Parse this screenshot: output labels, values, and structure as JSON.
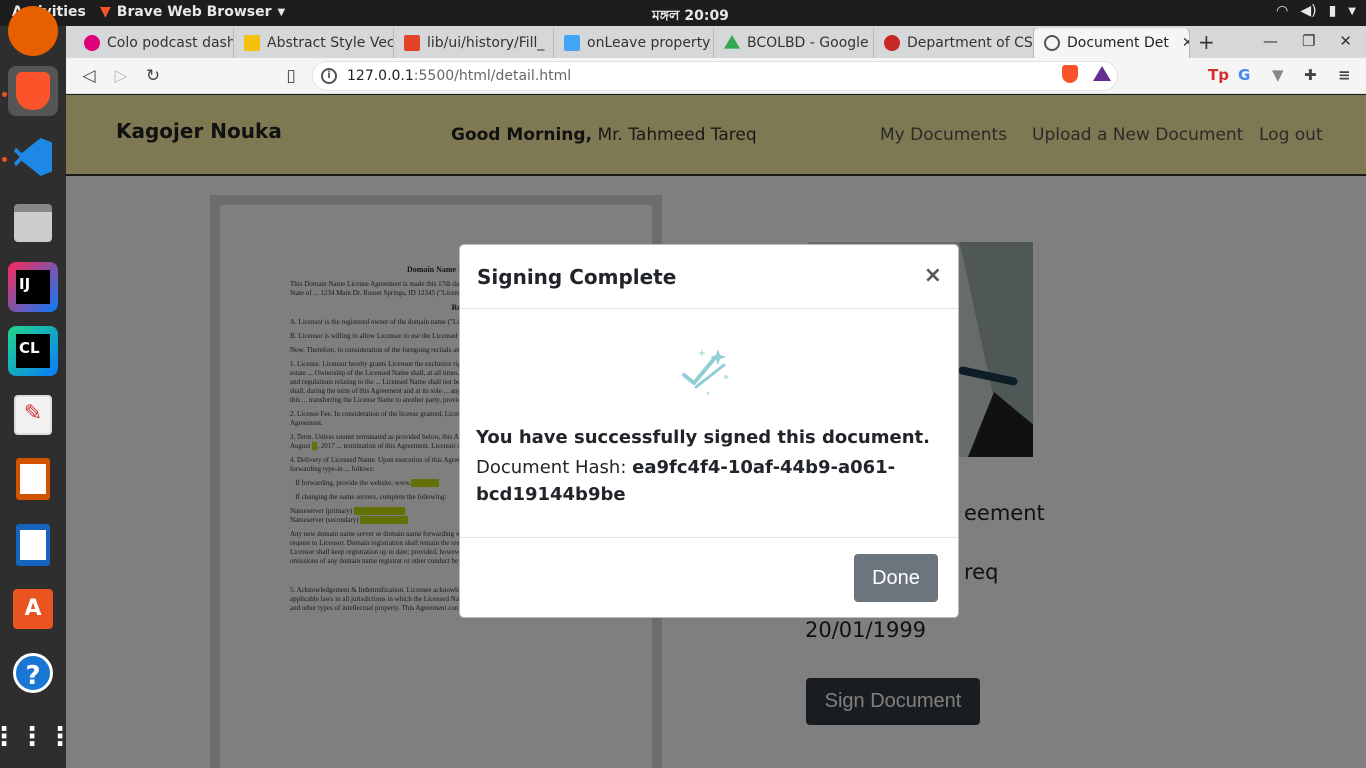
{
  "system": {
    "activities": "Activities",
    "app_name": "Brave Web Browser",
    "clock": "মঙ্গল 20:09"
  },
  "tabs": [
    {
      "label": "Colo podcast dash",
      "color": "#e0007a"
    },
    {
      "label": "Abstract Style Vec",
      "color": "#f4c20d"
    },
    {
      "label": "lib/ui/history/Fill_",
      "color": "#e24329"
    },
    {
      "label": "onLeave property",
      "color": "#42a5f5"
    },
    {
      "label": "BCOLBD - Google",
      "color": "#34a853"
    },
    {
      "label": "Department of CS",
      "color": "#c62828"
    },
    {
      "label": "Document Det",
      "color": "#555555"
    }
  ],
  "toolbar": {
    "url_host": "127.0.0.1",
    "url_rest": ":5500/html/detail.html"
  },
  "site": {
    "brand": "Kagojer Nouka",
    "greeting_bold": "Good Morning,",
    "greeting_name": " Mr. Tahmeed Tareq",
    "nav": [
      "My Documents",
      "Upload a New Document",
      "Log out"
    ]
  },
  "document_preview": {
    "title": "Domain Name License Agreement",
    "recitals": "Recitals"
  },
  "details": {
    "title_fragment": "eement",
    "name_fragment": "req",
    "date": "20/01/1999",
    "sign_button": "Sign Document"
  },
  "modal": {
    "title": "Signing Complete",
    "close": "×",
    "success": "You have successfully signed this document.",
    "hash_label": "Document Hash: ",
    "hash_value": "ea9fc4f4-10af-44b9-a061-bcd19144b9be",
    "done_button": "Done"
  },
  "colors": {
    "navbar_bg": "#fcf2a5",
    "done_button": "#6c757d",
    "sign_button": "#343a40"
  }
}
